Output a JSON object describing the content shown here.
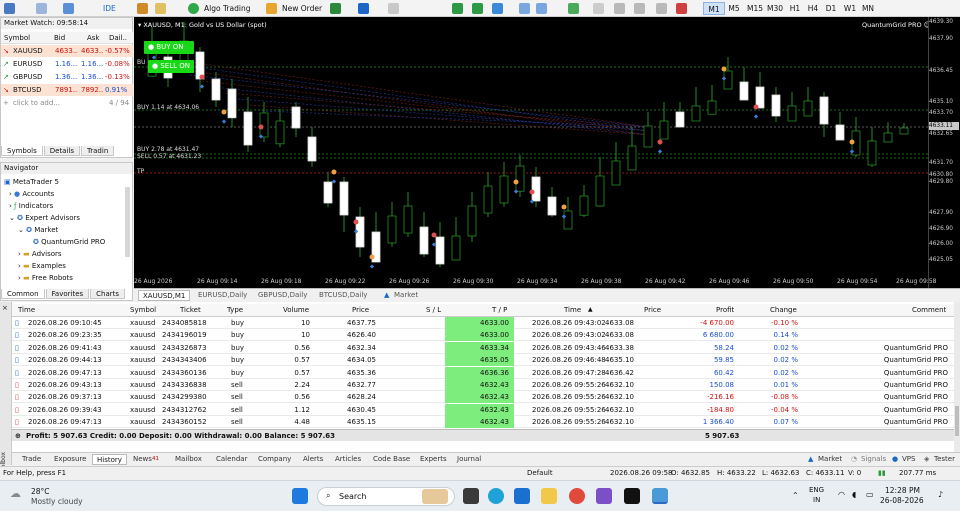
{
  "toolbar": {
    "algo_trading": "Algo Trading",
    "new_order": "New Order",
    "ide": "IDE",
    "timeframes": [
      "M1",
      "M5",
      "M15",
      "M30",
      "H1",
      "H4",
      "D1",
      "W1",
      "MN"
    ],
    "active_timeframe": "M1"
  },
  "market_watch": {
    "title": "Market Watch: 09:58:14",
    "columns": [
      "Symbol",
      "Bid",
      "Ask",
      "Dail.."
    ],
    "rows": [
      {
        "symbol": "XAUUSD",
        "bid": "4633...",
        "ask": "4633...",
        "daily": "-0.57%",
        "tone": "down"
      },
      {
        "symbol": "EURUSD",
        "bid": "1.16...",
        "ask": "1.16...",
        "daily": "-0.08%",
        "tone": "neutral"
      },
      {
        "symbol": "GBPUSD",
        "bid": "1.36...",
        "ask": "1.36...",
        "daily": "-0.13%",
        "tone": "neutral"
      },
      {
        "symbol": "BTCUSD",
        "bid": "7891...",
        "ask": "7892...",
        "daily": "0.91%",
        "tone": "up"
      }
    ],
    "add_hint": "click to add...",
    "count": "4 / 94",
    "tabs": [
      "Symbols",
      "Details",
      "Tradin"
    ]
  },
  "navigator": {
    "title": "Navigator",
    "items": [
      "MetaTrader 5",
      "Accounts",
      "Indicators",
      "Expert Advisors",
      "Market",
      "QuantumGrid PRO",
      "Advisors",
      "Examples",
      "Free Robots"
    ],
    "tabs": [
      "Common",
      "Favorites",
      "Charts"
    ]
  },
  "chart": {
    "title": "XAUUSD, M1:  Gold vs US Dollar (spot)",
    "ea_name": "QuantumGrid PRO",
    "buy_button": "BUY ON",
    "sell_button": "SELL ON",
    "labels": {
      "buy1": "BUY 1.14 at 4634.06",
      "buy2": "BUY 2.78 at 4631.47",
      "sell1": "SELL 0.57 at 4631.23",
      "tp": "TP",
      "bu": "BU"
    },
    "price_axis": [
      "4639.30",
      "4637.90",
      "4636.45",
      "4635.10",
      "4633.70",
      "4632.65",
      "4631.70",
      "4630.80",
      "4629.80",
      "4627.90",
      "4626.90",
      "4626.00",
      "4625.05"
    ],
    "current_price": "4633.11",
    "time_axis": [
      "26 Aug 2026",
      "26 Aug 09:14",
      "26 Aug 09:18",
      "26 Aug 09:22",
      "26 Aug 09:26",
      "26 Aug 09:30",
      "26 Aug 09:34",
      "26 Aug 09:38",
      "26 Aug 09:42",
      "26 Aug 09:46",
      "26 Aug 09:50",
      "26 Aug 09:54",
      "26 Aug 09:58"
    ],
    "tabs": [
      "XAUUSD,M1",
      "EURUSD,Daily",
      "GBPUSD,Daily",
      "BTCUSD,Daily",
      "Market"
    ]
  },
  "history": {
    "columns": [
      "Time",
      "Symbol",
      "Ticket",
      "Type",
      "Volume",
      "Price",
      "S / L",
      "T / P",
      "Time",
      "Price",
      "Profit",
      "Change",
      "Comment"
    ],
    "rows": [
      {
        "time": "2026.08.26 09:10:45",
        "symbol": "xauusd",
        "ticket": "2434085818",
        "type": "buy",
        "volume": "10",
        "price": "4637.75",
        "sl": "",
        "tp": "4633.00",
        "ctime": "2026.08.26 09:43:02",
        "cprice": "4633.08",
        "profit": "-4 670.00",
        "change": "-0.10 %",
        "comment": "",
        "tone": "neg"
      },
      {
        "time": "2026.08.26 09:23:35",
        "symbol": "xauusd",
        "ticket": "2434196019",
        "type": "buy",
        "volume": "10",
        "price": "4626.40",
        "sl": "",
        "tp": "4633.00",
        "ctime": "2026.08.26 09:43:02",
        "cprice": "4633.08",
        "profit": "6 680.00",
        "change": "0.14 %",
        "comment": "",
        "tone": "pos"
      },
      {
        "time": "2026.08.26 09:41:43",
        "symbol": "xauusd",
        "ticket": "2434326873",
        "type": "buy",
        "volume": "0.56",
        "price": "4632.34",
        "sl": "",
        "tp": "4633.34",
        "ctime": "2026.08.26 09:43:46",
        "cprice": "4633.38",
        "profit": "58.24",
        "change": "0.02 %",
        "comment": "QuantumGrid PRO",
        "tone": "pos"
      },
      {
        "time": "2026.08.26 09:44:13",
        "symbol": "xauusd",
        "ticket": "2434343406",
        "type": "buy",
        "volume": "0.57",
        "price": "4634.05",
        "sl": "",
        "tp": "4635.05",
        "ctime": "2026.08.26 09:46:48",
        "cprice": "4635.10",
        "profit": "59.85",
        "change": "0.02 %",
        "comment": "QuantumGrid PRO",
        "tone": "pos"
      },
      {
        "time": "2026.08.26 09:47:13",
        "symbol": "xauusd",
        "ticket": "2434360136",
        "type": "buy",
        "volume": "0.57",
        "price": "4635.36",
        "sl": "",
        "tp": "4636.36",
        "ctime": "2026.08.26 09:47:28",
        "cprice": "4636.42",
        "profit": "60.42",
        "change": "0.02 %",
        "comment": "QuantumGrid PRO",
        "tone": "pos"
      },
      {
        "time": "2026.08.26 09:43:13",
        "symbol": "xauusd",
        "ticket": "2434336838",
        "type": "sell",
        "volume": "2.24",
        "price": "4632.77",
        "sl": "",
        "tp": "4632.43",
        "ctime": "2026.08.26 09:55:26",
        "cprice": "4632.10",
        "profit": "150.08",
        "change": "0.01 %",
        "comment": "QuantumGrid PRO",
        "tone": "pos"
      },
      {
        "time": "2026.08.26 09:37:13",
        "symbol": "xauusd",
        "ticket": "2434299380",
        "type": "sell",
        "volume": "0.56",
        "price": "4628.24",
        "sl": "",
        "tp": "4632.43",
        "ctime": "2026.08.26 09:55:26",
        "cprice": "4632.10",
        "profit": "-216.16",
        "change": "-0.08 %",
        "comment": "QuantumGrid PRO",
        "tone": "neg"
      },
      {
        "time": "2026.08.26 09:39:43",
        "symbol": "xauusd",
        "ticket": "2434312762",
        "type": "sell",
        "volume": "1.12",
        "price": "4630.45",
        "sl": "",
        "tp": "4632.43",
        "ctime": "2026.08.26 09:55:26",
        "cprice": "4632.10",
        "profit": "-184.80",
        "change": "-0.04 %",
        "comment": "QuantumGrid PRO",
        "tone": "neg"
      },
      {
        "time": "2026.08.26 09:47:13",
        "symbol": "xauusd",
        "ticket": "2434360152",
        "type": "sell",
        "volume": "4.48",
        "price": "4635.15",
        "sl": "",
        "tp": "4632.43",
        "ctime": "2026.08.26 09:55:26",
        "cprice": "4632.10",
        "profit": "1 366.40",
        "change": "0.07 %",
        "comment": "QuantumGrid PRO",
        "tone": "pos"
      }
    ],
    "summary": "Profit: 5 907.63  Credit: 0.00  Deposit: 0.00  Withdrawal: 0.00  Balance: 5 907.63",
    "summary_total": "5 907.63"
  },
  "bottom_tabs": {
    "items": [
      "Trade",
      "Exposure",
      "History",
      "News",
      "Mailbox",
      "Calendar",
      "Company",
      "Alerts",
      "Articles",
      "Code Base",
      "Experts",
      "Journal"
    ],
    "news_badge": "41",
    "active": "History",
    "right": [
      "Market",
      "Signals",
      "VPS",
      "Tester"
    ],
    "toolbox": "Toolbox"
  },
  "status_bar": {
    "help": "For Help, press F1",
    "profile": "Default",
    "datetime": "2026.08.26 09:58",
    "open": "O: 4632.85",
    "high": "H: 4633.22",
    "low": "L: 4632.63",
    "close": "C: 4633.11",
    "volume": "V: 0",
    "ping": "207.77 ms"
  },
  "taskbar": {
    "temp": "28°C",
    "weather": "Mostly cloudy",
    "search": "Search",
    "lang1": "ENG",
    "lang2": "IN",
    "time": "12:28 PM",
    "date": "26-08-2026"
  },
  "colors": {
    "accent": "#1a66c9",
    "tp_green": "#7ded7d",
    "neg": "#d01010",
    "pos": "#1a4fd0",
    "chart_bg": "#000000",
    "buy_green": "#18d818"
  }
}
